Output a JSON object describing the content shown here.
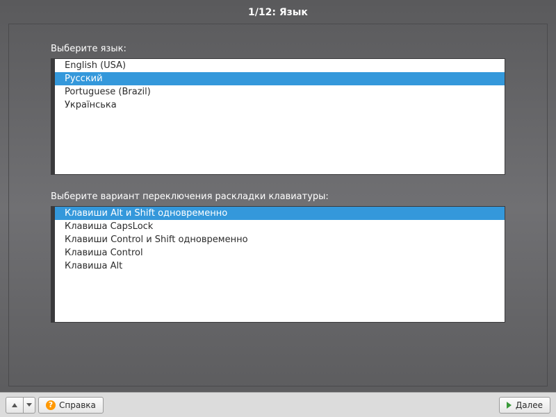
{
  "header": {
    "title": "1/12: Язык"
  },
  "language": {
    "label": "Выберите язык:",
    "items": [
      {
        "label": "English (USA)",
        "selected": false
      },
      {
        "label": "Русский",
        "selected": true
      },
      {
        "label": "Portuguese (Brazil)",
        "selected": false
      },
      {
        "label": "Українська",
        "selected": false
      }
    ]
  },
  "layout": {
    "label": "Выберите вариант переключения раскладки клавиатуры:",
    "items": [
      {
        "label": "Клавиши Alt и Shift одновременно",
        "selected": true
      },
      {
        "label": "Клавиша CapsLock",
        "selected": false
      },
      {
        "label": "Клавиши Control и Shift одновременно",
        "selected": false
      },
      {
        "label": "Клавиша Control",
        "selected": false
      },
      {
        "label": "Клавиша Alt",
        "selected": false
      }
    ]
  },
  "footer": {
    "help_label": "Справка",
    "next_label": "Далее"
  }
}
